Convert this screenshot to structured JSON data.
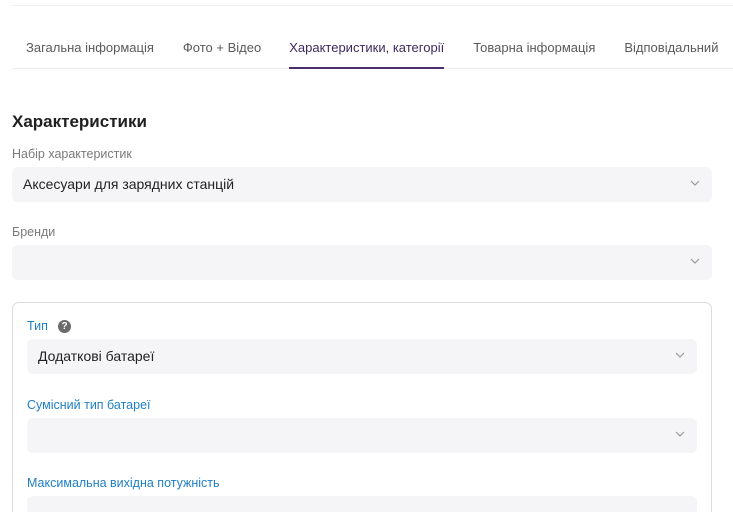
{
  "tabs": [
    {
      "label": "Загальна інформація",
      "active": false
    },
    {
      "label": "Фото + Відео",
      "active": false
    },
    {
      "label": "Характеристики, категорії",
      "active": true
    },
    {
      "label": "Товарна інформація",
      "active": false
    },
    {
      "label": "Відповідальний",
      "active": false
    }
  ],
  "section": {
    "title": "Характеристики"
  },
  "fields": {
    "char_set": {
      "label": "Набір характеристик",
      "value": "Аксесуари для зарядних станцій"
    },
    "brands": {
      "label": "Бренди",
      "value": ""
    }
  },
  "card": {
    "type": {
      "label": "Тип",
      "help_icon": "?",
      "value": "Додаткові батареї"
    },
    "compat": {
      "label": "Сумісний тип батареї",
      "value": ""
    },
    "max_power": {
      "label": "Максимальна вихідна потужність",
      "value": ""
    }
  },
  "icons": {
    "chevron": "chevron-down-icon",
    "help": "question-circle-icon"
  },
  "colors": {
    "accent": "#4b2e6b",
    "label_blue": "#1f7fc4",
    "field_bg": "#f5f4f7"
  }
}
